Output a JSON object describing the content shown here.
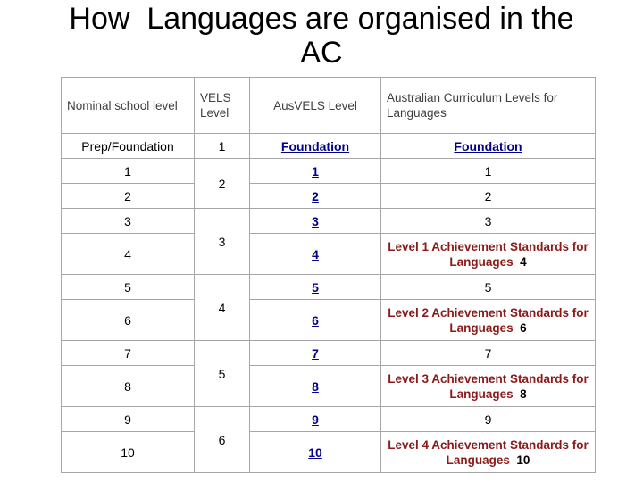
{
  "slide": {
    "title": "How  Languages are organised in the\nAC"
  },
  "colors": {
    "link": "#00008b",
    "achievement": "#8b1a1a",
    "border": "#a6a6a6",
    "header_text": "#3f3f3f",
    "body_text": "#000000",
    "background": "#ffffff"
  },
  "table": {
    "headers": [
      "Nominal school level",
      "VELS Level",
      "AusVELS Level",
      "Australian Curriculum Levels for Languages"
    ],
    "rows": [
      {
        "nominal": "Prep/Foundation",
        "vels": "1",
        "vels_rowspan": 1,
        "ausvels": "Foundation",
        "ausvels_link": true,
        "ac_text": "Foundation",
        "ac_link": true,
        "ac_number": "",
        "tall": false
      },
      {
        "nominal": "1",
        "vels": "2",
        "vels_rowspan": 2,
        "ausvels": "1",
        "ausvels_link": true,
        "ac_text": "1",
        "ac_link": false,
        "ac_number": "",
        "tall": false
      },
      {
        "nominal": "2",
        "vels": null,
        "vels_rowspan": 0,
        "ausvels": "2",
        "ausvels_link": true,
        "ac_text": "2",
        "ac_link": false,
        "ac_number": "",
        "tall": false
      },
      {
        "nominal": "3",
        "vels": "3",
        "vels_rowspan": 2,
        "ausvels": "3",
        "ausvels_link": true,
        "ac_text": "3",
        "ac_link": false,
        "ac_number": "",
        "tall": false
      },
      {
        "nominal": "4",
        "vels": null,
        "vels_rowspan": 0,
        "ausvels": "4",
        "ausvels_link": true,
        "ac_text": "Level 1 Achievement Standards for Languages",
        "ac_link": false,
        "ac_number": "4",
        "tall": true
      },
      {
        "nominal": "5",
        "vels": "4",
        "vels_rowspan": 2,
        "ausvels": "5",
        "ausvels_link": true,
        "ac_text": "5",
        "ac_link": false,
        "ac_number": "",
        "tall": false
      },
      {
        "nominal": "6",
        "vels": null,
        "vels_rowspan": 0,
        "ausvels": "6",
        "ausvels_link": true,
        "ac_text": "Level 2 Achievement Standards for Languages",
        "ac_link": false,
        "ac_number": "6",
        "tall": true
      },
      {
        "nominal": "7",
        "vels": "5",
        "vels_rowspan": 2,
        "ausvels": "7",
        "ausvels_link": true,
        "ac_text": "7",
        "ac_link": false,
        "ac_number": "",
        "tall": false
      },
      {
        "nominal": "8",
        "vels": null,
        "vels_rowspan": 0,
        "ausvels": "8",
        "ausvels_link": true,
        "ac_text": "Level 3 Achievement Standards for Languages",
        "ac_link": false,
        "ac_number": "8",
        "tall": true
      },
      {
        "nominal": "9",
        "vels": "6",
        "vels_rowspan": 2,
        "ausvels": "9",
        "ausvels_link": true,
        "ac_text": "9",
        "ac_link": false,
        "ac_number": "",
        "tall": false
      },
      {
        "nominal": "10",
        "vels": null,
        "vels_rowspan": 0,
        "ausvels": "10",
        "ausvels_link": true,
        "ac_text": "Level 4 Achievement Standards for Languages",
        "ac_link": false,
        "ac_number": "10",
        "tall": true
      }
    ]
  }
}
